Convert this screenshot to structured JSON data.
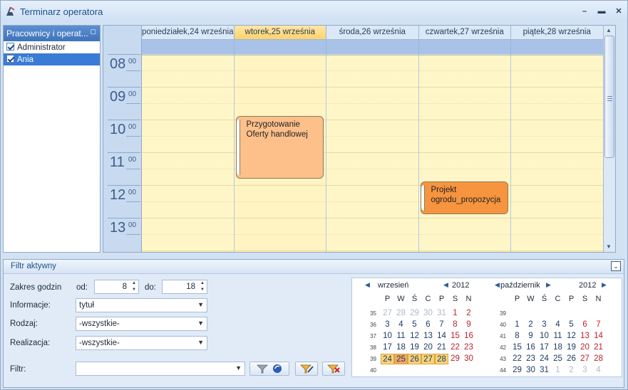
{
  "window": {
    "title": "Terminarz operatora"
  },
  "users_panel": {
    "title": "Pracownicy i operat...",
    "items": [
      {
        "label": "Administrator",
        "checked": true,
        "selected": false
      },
      {
        "label": "Ania",
        "checked": true,
        "selected": true
      }
    ]
  },
  "calendar": {
    "days": [
      {
        "label": "poniedziałek,24 września",
        "today": false
      },
      {
        "label": "wtorek,25 września",
        "today": true
      },
      {
        "label": "środa,26 września",
        "today": false
      },
      {
        "label": "czwartek,27 września",
        "today": false
      },
      {
        "label": "piątek,28 września",
        "today": false
      }
    ],
    "hours": [
      {
        "h": "08",
        "m": "00"
      },
      {
        "h": "09",
        "m": "00"
      },
      {
        "h": "10",
        "m": "00"
      },
      {
        "h": "11",
        "m": "00"
      },
      {
        "h": "12",
        "m": "00"
      },
      {
        "h": "13",
        "m": "00"
      }
    ],
    "appointments": [
      {
        "day": 1,
        "start": 9.9,
        "end": 11.8,
        "lines": [
          "Przygotowanie",
          "Oferty handlowej"
        ],
        "color": "#fdc08b"
      },
      {
        "day": 3,
        "start": 11.9,
        "end": 12.9,
        "lines": [
          "Projekt",
          "ogrodu_propozycja"
        ],
        "color": "#f7943f"
      }
    ]
  },
  "filter": {
    "title": "Filtr aktywny",
    "labels": {
      "hours_range": "Zakres godzin",
      "from": "od:",
      "to": "do:",
      "info": "Informacje:",
      "kind": "Rodzaj:",
      "realization": "Realizacja:",
      "filter": "Filtr:"
    },
    "from_value": "8",
    "to_value": "18",
    "info_value": "tytuł",
    "kind_value": "-wszystkie-",
    "realization_value": "-wszystkie-",
    "filter_value": ""
  },
  "mini_calendars": {
    "weekdays": [
      "P",
      "W",
      "Ś",
      "C",
      "P",
      "S",
      "N"
    ],
    "months": [
      {
        "month": "wrzesień",
        "year": "2012",
        "weeks": [
          "35",
          "36",
          "37",
          "38",
          "39",
          "40"
        ],
        "rows": [
          [
            "27",
            "28",
            "29",
            "30",
            "31",
            "1",
            "2"
          ],
          [
            "3",
            "4",
            "5",
            "6",
            "7",
            "8",
            "9"
          ],
          [
            "10",
            "11",
            "12",
            "13",
            "14",
            "15",
            "16"
          ],
          [
            "17",
            "18",
            "19",
            "20",
            "21",
            "22",
            "23"
          ],
          [
            "24",
            "25",
            "26",
            "27",
            "28",
            "29",
            "30"
          ],
          [
            "",
            "",
            "",
            "",
            "",
            "",
            ""
          ]
        ]
      },
      {
        "month": "październik",
        "year": "2012",
        "weeks": [
          "39",
          "40",
          "41",
          "42",
          "43",
          "44"
        ],
        "rows": [
          [
            "",
            "",
            "",
            "",
            "",
            "",
            ""
          ],
          [
            "1",
            "2",
            "3",
            "4",
            "5",
            "6",
            "7"
          ],
          [
            "8",
            "9",
            "10",
            "11",
            "12",
            "13",
            "14"
          ],
          [
            "15",
            "16",
            "17",
            "18",
            "19",
            "20",
            "21"
          ],
          [
            "22",
            "23",
            "24",
            "25",
            "26",
            "27",
            "28"
          ],
          [
            "29",
            "30",
            "31",
            "1",
            "2",
            "3",
            "4"
          ]
        ]
      }
    ]
  }
}
